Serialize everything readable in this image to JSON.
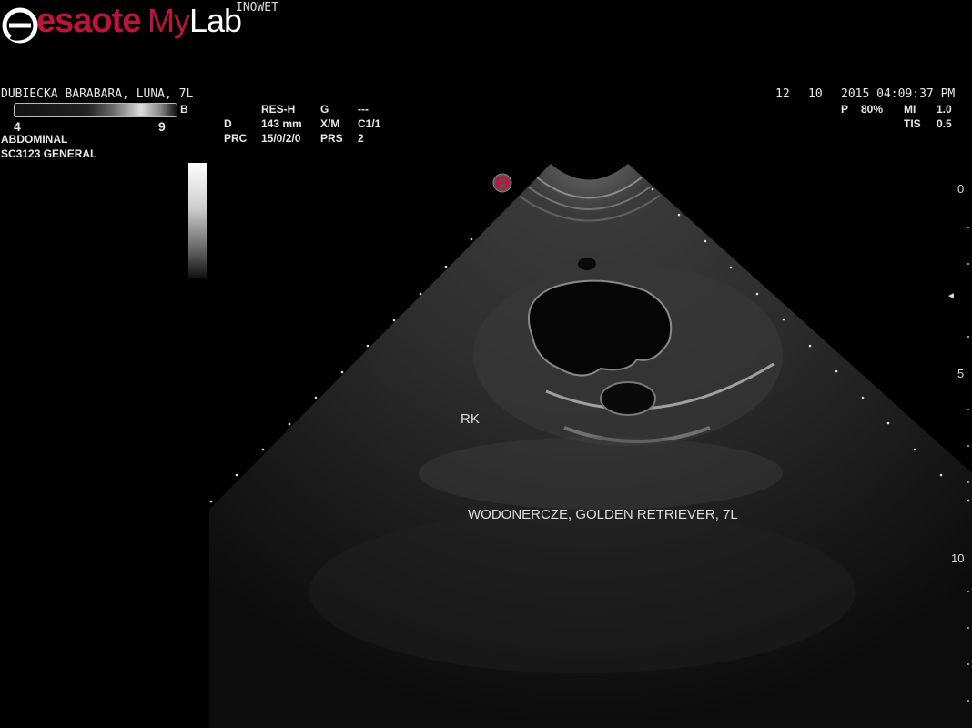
{
  "logo": {
    "brand": "esaote",
    "product_prefix": "My",
    "product_suffix": "Lab"
  },
  "clinic": "INOWET",
  "patient": "DUBIECKA BARABARA, LUNA, 7L",
  "datetime": {
    "day": "12",
    "month": "10",
    "year_time": "2015 04:09:37 PM"
  },
  "grayscale": {
    "mode": "B",
    "min": "4",
    "max": "9"
  },
  "exam": {
    "type": "ABDOMINAL",
    "probe": "SC3123  GENERAL"
  },
  "params": {
    "res_label": "RES-H",
    "g_label": "G",
    "g_value": "---",
    "d_label": "D",
    "d_value": "143 mm",
    "xm_label": "X/M",
    "xm_value": "C1/1",
    "prc_label": "PRC",
    "prc_value": "15/0/2/0",
    "prs_label": "PRS",
    "prs_value": "2"
  },
  "power": {
    "p_label": "P",
    "p_value": "80%",
    "mi_label": "MI",
    "mi_value": "1.0",
    "tis_label": "TIS",
    "tis_value": "0.5"
  },
  "annotations": {
    "organ": "RK",
    "diagnosis": "WODONERCZE, GOLDEN RETRIEVER, 7L"
  },
  "depth_scale": [
    "0",
    "5",
    "10"
  ],
  "focus_marker": "◄"
}
